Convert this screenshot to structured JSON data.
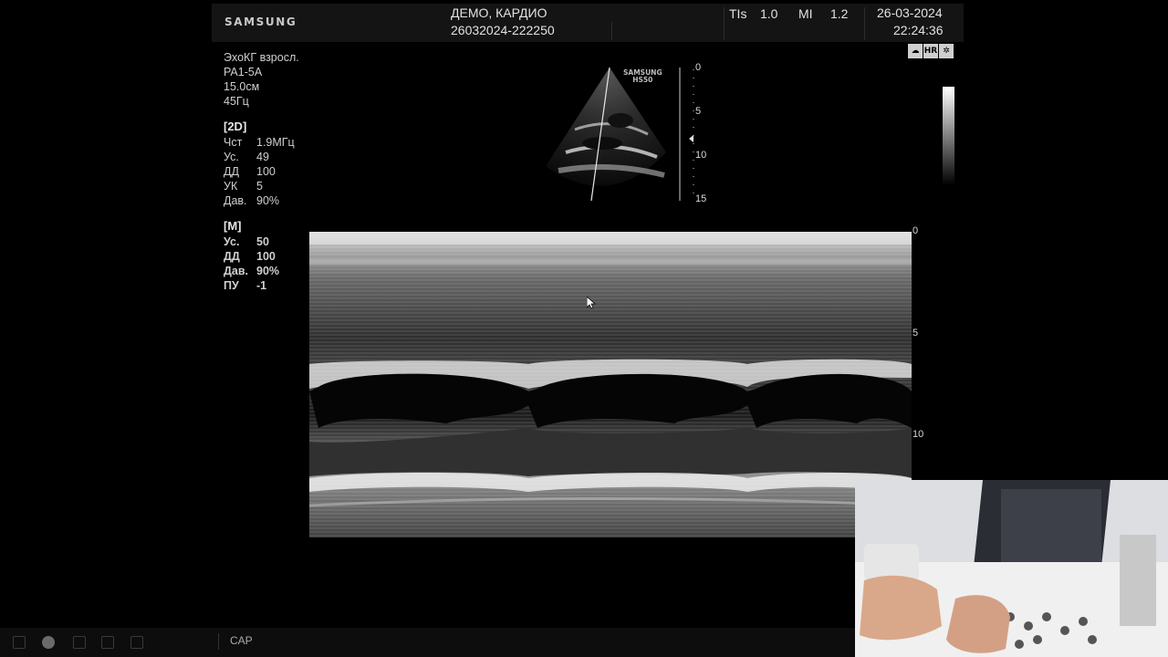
{
  "header": {
    "brand": "SAMSUNG",
    "patient": "ДЕМО, КАРДИО",
    "study_id": "26032024-222250",
    "tis_label": "TIs",
    "tis_value": "1.0",
    "mi_label": "MI",
    "mi_value": "1.2",
    "date": "26-03-2024",
    "time": "22:24:36"
  },
  "preset": {
    "exam": "ЭхоКГ взросл.",
    "probe": "PA1-5A",
    "depth": "15.0см",
    "frame_rate": "45Гц"
  },
  "params_2d": {
    "title": "[2D]",
    "rows": [
      {
        "k": "Чст",
        "v": "1.9МГц"
      },
      {
        "k": "Ус.",
        "v": "49"
      },
      {
        "k": "ДД",
        "v": "100"
      },
      {
        "k": "УК",
        "v": "5"
      },
      {
        "k": "Дав.",
        "v": "90%"
      }
    ]
  },
  "params_m": {
    "title": "[M]",
    "rows": [
      {
        "k": "Ус.",
        "v": "50"
      },
      {
        "k": "ДД",
        "v": "100"
      },
      {
        "k": "Дав.",
        "v": "90%"
      },
      {
        "k": "ПУ",
        "v": "-1"
      }
    ]
  },
  "top_icons": [
    "cloud-icon",
    "hr-badge-icon",
    "snowflake-icon"
  ],
  "top_icon_labels": {
    "hr": "HR"
  },
  "sector_label": {
    "line1": "SAMSUNG",
    "line2": "HS50"
  },
  "depth_2d_ticks": [
    "0",
    "5",
    "10",
    "15"
  ],
  "depth_m_ticks": [
    "0",
    "5",
    "10"
  ],
  "status": {
    "cap": "CAP"
  },
  "bottom_icons": [
    "window-icon",
    "record-icon",
    "delete-icon",
    "print-icon",
    "display-icon"
  ]
}
